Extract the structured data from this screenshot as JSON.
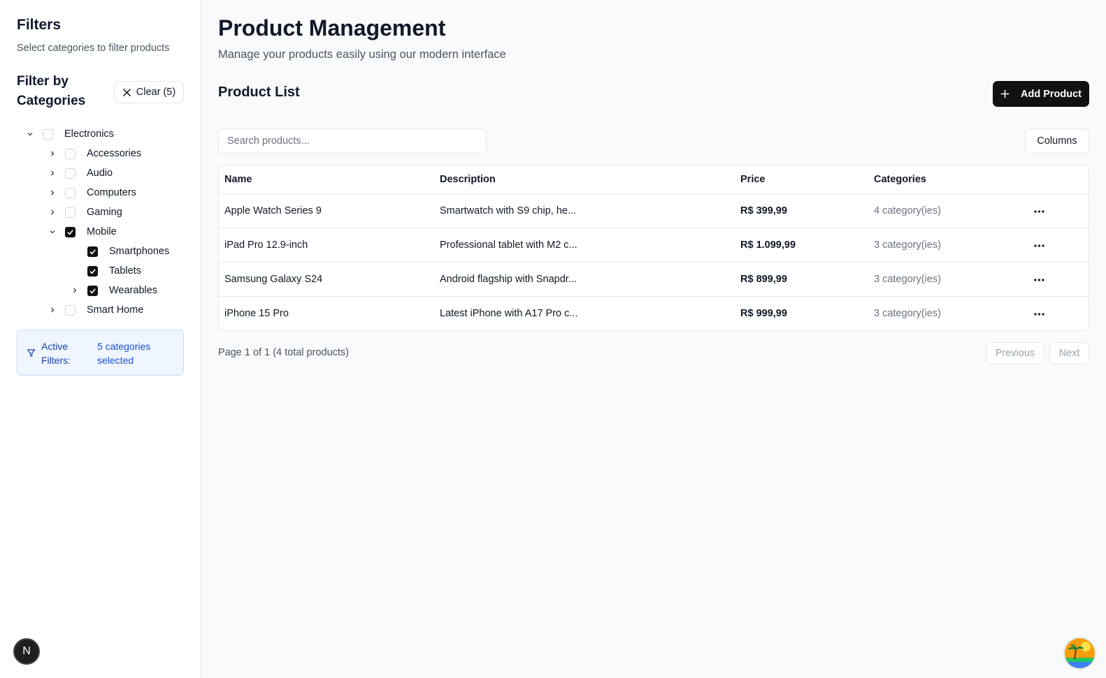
{
  "sidebar": {
    "title": "Filters",
    "subtitle": "Select categories to filter products",
    "filter_heading": "Filter by Categories",
    "clear_label": "Clear (5)",
    "tree": [
      {
        "label": "Electronics",
        "checked": false,
        "expanded": true
      },
      {
        "label": "Accessories",
        "checked": false,
        "expanded": false
      },
      {
        "label": "Audio",
        "checked": false,
        "expanded": false
      },
      {
        "label": "Computers",
        "checked": false,
        "expanded": false
      },
      {
        "label": "Gaming",
        "checked": false,
        "expanded": false
      },
      {
        "label": "Mobile",
        "checked": true,
        "expanded": true
      },
      {
        "label": "Smartphones",
        "checked": true
      },
      {
        "label": "Tablets",
        "checked": true
      },
      {
        "label": "Wearables",
        "checked": true,
        "expanded": false
      },
      {
        "label": "Smart Home",
        "checked": false,
        "expanded": false
      }
    ],
    "active_filters_label": "Active Filters:",
    "active_filters_value": "5 categories selected"
  },
  "main": {
    "title": "Product Management",
    "subtitle": "Manage your products easily using our modern interface",
    "list_title": "Product List",
    "add_button": "Add Product",
    "search_placeholder": "Search products...",
    "columns_button": "Columns",
    "table": {
      "headers": [
        "Name",
        "Description",
        "Price",
        "Categories"
      ],
      "rows": [
        {
          "name": "Apple Watch Series 9",
          "description": "Smartwatch with S9 chip, he...",
          "price": "R$ 399,99",
          "categories": "4 category(ies)"
        },
        {
          "name": "iPad Pro 12.9-inch",
          "description": "Professional tablet with M2 c...",
          "price": "R$ 1.099,99",
          "categories": "3 category(ies)"
        },
        {
          "name": "Samsung Galaxy S24",
          "description": "Android flagship with Snapdr...",
          "price": "R$ 899,99",
          "categories": "3 category(ies)"
        },
        {
          "name": "iPhone 15 Pro",
          "description": "Latest iPhone with A17 Pro c...",
          "price": "R$ 999,99",
          "categories": "3 category(ies)"
        }
      ]
    },
    "page_info": "Page 1 of 1 (4 total products)",
    "previous": "Previous",
    "next": "Next"
  },
  "badge_letter": "N",
  "colors": {
    "accent": "#111111",
    "active_bg": "#eff6ff",
    "active_text": "#1e40af"
  }
}
